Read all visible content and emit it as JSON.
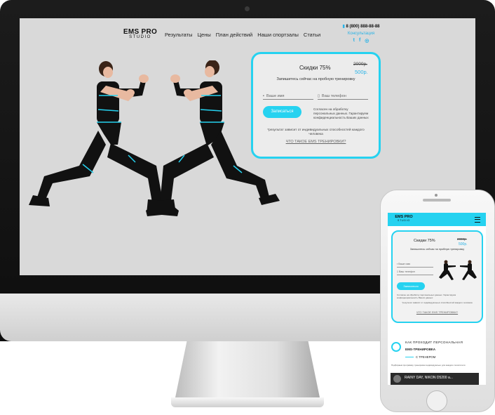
{
  "desktop": {
    "logo": {
      "line1": "EMS PRO",
      "line2": "STUDIO"
    },
    "nav": [
      "Результаты",
      "Цены",
      "План действий",
      "Наши спортзалы",
      "Статьи"
    ],
    "contact": {
      "phone": "8 (800) 888-88-88",
      "consult": "Консультация"
    },
    "social": [
      "twitter-icon",
      "facebook-icon",
      "instagram-icon"
    ],
    "form": {
      "discount": "Скидки 75%",
      "old_price": "2000р.",
      "new_price": "500р.",
      "subtitle": "Запишитесь сейчас на пробную тренировку",
      "name_placeholder": "Ваше имя",
      "phone_placeholder": "Ваш телефон",
      "submit": "Записаться",
      "agreement": "Согласен на обработку персональных данных. Гарантируем конфиденциальность Ваших данных",
      "note": "*результат зависит от индивидуальных способностей каждого человека",
      "what_link": "ЧТО ТАКОЕ EMS ТРЕНИРОВКИ?"
    }
  },
  "mobile": {
    "logo": {
      "line1": "EMS PRO",
      "line2": "STUDIO"
    },
    "form": {
      "discount": "Скидки 75%",
      "old_price": "2000р.",
      "new_price": "500р.",
      "subtitle": "Запишитесь сейчас на пробную тренировку",
      "name_placeholder": "Ваше имя",
      "phone_placeholder": "Ваш телефон",
      "submit": "Записаться",
      "agreement": "Согласен на обработку персональных данных. Гарантируем конфиденциальность Ваших данных",
      "note": "*результат зависит от индивидуальных способностей каждого человека",
      "what_link": "ЧТО ТАКОЕ EMS ТРЕНИРОВКИ?"
    },
    "section": {
      "title1": "КАК ПРОХОДИТ ПЕРСОНАЛЬНАЯ",
      "title2": "EMS-ТРЕНИРОВКА",
      "title3": "С ТРЕНЕРОМ",
      "desc": "Подбираем программу тренировок индивидуально для каждого посетителя",
      "video_title": "RAINY DAY, NIKON D5200 a..."
    }
  },
  "colors": {
    "accent": "#26d2f0",
    "link": "#2ab3e6",
    "suit": "#111111"
  }
}
